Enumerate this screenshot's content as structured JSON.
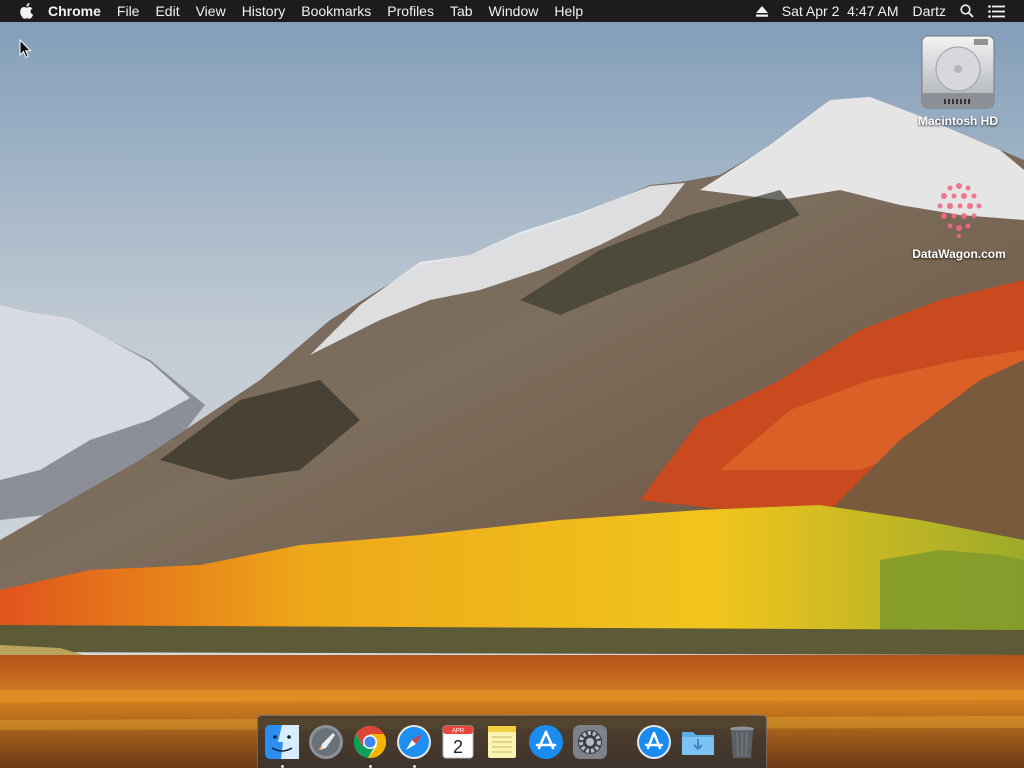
{
  "menubar": {
    "apple_icon": "apple-logo-icon",
    "app_name": "Chrome",
    "menus": [
      "File",
      "Edit",
      "View",
      "History",
      "Bookmarks",
      "Profiles",
      "Tab",
      "Window",
      "Help"
    ],
    "status": {
      "eject_icon": "eject-icon",
      "datetime": "Sat Apr 2  4:47 AM",
      "user": "Dartz",
      "search_icon": "spotlight-search-icon",
      "menu_icon": "notification-center-icon"
    }
  },
  "desktop": {
    "icons": [
      {
        "label": "Macintosh HD",
        "icon": "hard-drive-icon"
      },
      {
        "label": "DataWagon.com",
        "icon": "datawagon-logo-icon"
      }
    ]
  },
  "dock": {
    "items": [
      {
        "name": "Finder",
        "icon": "finder-icon",
        "running": true
      },
      {
        "name": "Launchpad",
        "icon": "launchpad-icon",
        "running": false
      },
      {
        "name": "Google Chrome",
        "icon": "chrome-icon",
        "running": true
      },
      {
        "name": "Safari",
        "icon": "safari-icon",
        "running": true
      },
      {
        "name": "Calendar",
        "icon": "calendar-icon",
        "running": false,
        "month": "APR",
        "day": "2"
      },
      {
        "name": "Notes",
        "icon": "notes-icon",
        "running": false
      },
      {
        "name": "App Store",
        "icon": "app-store-icon",
        "running": false
      },
      {
        "name": "System Preferences",
        "icon": "system-preferences-icon",
        "running": false
      },
      {
        "name": "Applications",
        "icon": "applications-folder-icon",
        "running": false
      },
      {
        "name": "Downloads",
        "icon": "downloads-folder-icon",
        "running": false
      },
      {
        "name": "Trash",
        "icon": "trash-icon",
        "running": false
      }
    ]
  },
  "colors": {
    "menubar_bg": "#1c1c1e",
    "menubar_text": "#f2f2f2"
  }
}
